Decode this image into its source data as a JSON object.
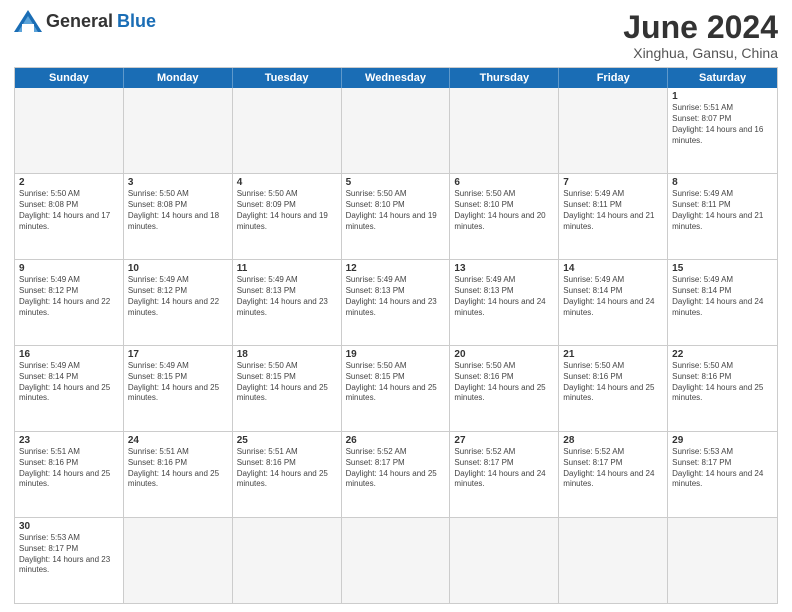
{
  "header": {
    "logo": {
      "text_general": "General",
      "text_blue": "Blue"
    },
    "title": "June 2024",
    "location": "Xinghua, Gansu, China"
  },
  "weekdays": [
    "Sunday",
    "Monday",
    "Tuesday",
    "Wednesday",
    "Thursday",
    "Friday",
    "Saturday"
  ],
  "weeks": [
    [
      {
        "day": "",
        "empty": true
      },
      {
        "day": "",
        "empty": true
      },
      {
        "day": "",
        "empty": true
      },
      {
        "day": "",
        "empty": true
      },
      {
        "day": "",
        "empty": true
      },
      {
        "day": "",
        "empty": true
      },
      {
        "day": "1",
        "sunrise": "Sunrise: 5:51 AM",
        "sunset": "Sunset: 8:07 PM",
        "daylight": "Daylight: 14 hours and 16 minutes."
      }
    ],
    [
      {
        "day": "2",
        "sunrise": "Sunrise: 5:50 AM",
        "sunset": "Sunset: 8:08 PM",
        "daylight": "Daylight: 14 hours and 17 minutes."
      },
      {
        "day": "3",
        "sunrise": "Sunrise: 5:50 AM",
        "sunset": "Sunset: 8:08 PM",
        "daylight": "Daylight: 14 hours and 18 minutes."
      },
      {
        "day": "4",
        "sunrise": "Sunrise: 5:50 AM",
        "sunset": "Sunset: 8:09 PM",
        "daylight": "Daylight: 14 hours and 19 minutes."
      },
      {
        "day": "5",
        "sunrise": "Sunrise: 5:50 AM",
        "sunset": "Sunset: 8:10 PM",
        "daylight": "Daylight: 14 hours and 19 minutes."
      },
      {
        "day": "6",
        "sunrise": "Sunrise: 5:50 AM",
        "sunset": "Sunset: 8:10 PM",
        "daylight": "Daylight: 14 hours and 20 minutes."
      },
      {
        "day": "7",
        "sunrise": "Sunrise: 5:49 AM",
        "sunset": "Sunset: 8:11 PM",
        "daylight": "Daylight: 14 hours and 21 minutes."
      },
      {
        "day": "8",
        "sunrise": "Sunrise: 5:49 AM",
        "sunset": "Sunset: 8:11 PM",
        "daylight": "Daylight: 14 hours and 21 minutes."
      }
    ],
    [
      {
        "day": "9",
        "sunrise": "Sunrise: 5:49 AM",
        "sunset": "Sunset: 8:12 PM",
        "daylight": "Daylight: 14 hours and 22 minutes."
      },
      {
        "day": "10",
        "sunrise": "Sunrise: 5:49 AM",
        "sunset": "Sunset: 8:12 PM",
        "daylight": "Daylight: 14 hours and 22 minutes."
      },
      {
        "day": "11",
        "sunrise": "Sunrise: 5:49 AM",
        "sunset": "Sunset: 8:13 PM",
        "daylight": "Daylight: 14 hours and 23 minutes."
      },
      {
        "day": "12",
        "sunrise": "Sunrise: 5:49 AM",
        "sunset": "Sunset: 8:13 PM",
        "daylight": "Daylight: 14 hours and 23 minutes."
      },
      {
        "day": "13",
        "sunrise": "Sunrise: 5:49 AM",
        "sunset": "Sunset: 8:13 PM",
        "daylight": "Daylight: 14 hours and 24 minutes."
      },
      {
        "day": "14",
        "sunrise": "Sunrise: 5:49 AM",
        "sunset": "Sunset: 8:14 PM",
        "daylight": "Daylight: 14 hours and 24 minutes."
      },
      {
        "day": "15",
        "sunrise": "Sunrise: 5:49 AM",
        "sunset": "Sunset: 8:14 PM",
        "daylight": "Daylight: 14 hours and 24 minutes."
      }
    ],
    [
      {
        "day": "16",
        "sunrise": "Sunrise: 5:49 AM",
        "sunset": "Sunset: 8:14 PM",
        "daylight": "Daylight: 14 hours and 25 minutes."
      },
      {
        "day": "17",
        "sunrise": "Sunrise: 5:49 AM",
        "sunset": "Sunset: 8:15 PM",
        "daylight": "Daylight: 14 hours and 25 minutes."
      },
      {
        "day": "18",
        "sunrise": "Sunrise: 5:50 AM",
        "sunset": "Sunset: 8:15 PM",
        "daylight": "Daylight: 14 hours and 25 minutes."
      },
      {
        "day": "19",
        "sunrise": "Sunrise: 5:50 AM",
        "sunset": "Sunset: 8:15 PM",
        "daylight": "Daylight: 14 hours and 25 minutes."
      },
      {
        "day": "20",
        "sunrise": "Sunrise: 5:50 AM",
        "sunset": "Sunset: 8:16 PM",
        "daylight": "Daylight: 14 hours and 25 minutes."
      },
      {
        "day": "21",
        "sunrise": "Sunrise: 5:50 AM",
        "sunset": "Sunset: 8:16 PM",
        "daylight": "Daylight: 14 hours and 25 minutes."
      },
      {
        "day": "22",
        "sunrise": "Sunrise: 5:50 AM",
        "sunset": "Sunset: 8:16 PM",
        "daylight": "Daylight: 14 hours and 25 minutes."
      }
    ],
    [
      {
        "day": "23",
        "sunrise": "Sunrise: 5:51 AM",
        "sunset": "Sunset: 8:16 PM",
        "daylight": "Daylight: 14 hours and 25 minutes."
      },
      {
        "day": "24",
        "sunrise": "Sunrise: 5:51 AM",
        "sunset": "Sunset: 8:16 PM",
        "daylight": "Daylight: 14 hours and 25 minutes."
      },
      {
        "day": "25",
        "sunrise": "Sunrise: 5:51 AM",
        "sunset": "Sunset: 8:16 PM",
        "daylight": "Daylight: 14 hours and 25 minutes."
      },
      {
        "day": "26",
        "sunrise": "Sunrise: 5:52 AM",
        "sunset": "Sunset: 8:17 PM",
        "daylight": "Daylight: 14 hours and 25 minutes."
      },
      {
        "day": "27",
        "sunrise": "Sunrise: 5:52 AM",
        "sunset": "Sunset: 8:17 PM",
        "daylight": "Daylight: 14 hours and 24 minutes."
      },
      {
        "day": "28",
        "sunrise": "Sunrise: 5:52 AM",
        "sunset": "Sunset: 8:17 PM",
        "daylight": "Daylight: 14 hours and 24 minutes."
      },
      {
        "day": "29",
        "sunrise": "Sunrise: 5:53 AM",
        "sunset": "Sunset: 8:17 PM",
        "daylight": "Daylight: 14 hours and 24 minutes."
      }
    ],
    [
      {
        "day": "30",
        "sunrise": "Sunrise: 5:53 AM",
        "sunset": "Sunset: 8:17 PM",
        "daylight": "Daylight: 14 hours and 23 minutes."
      },
      {
        "day": "",
        "empty": true
      },
      {
        "day": "",
        "empty": true
      },
      {
        "day": "",
        "empty": true
      },
      {
        "day": "",
        "empty": true
      },
      {
        "day": "",
        "empty": true
      },
      {
        "day": "",
        "empty": true
      }
    ]
  ]
}
